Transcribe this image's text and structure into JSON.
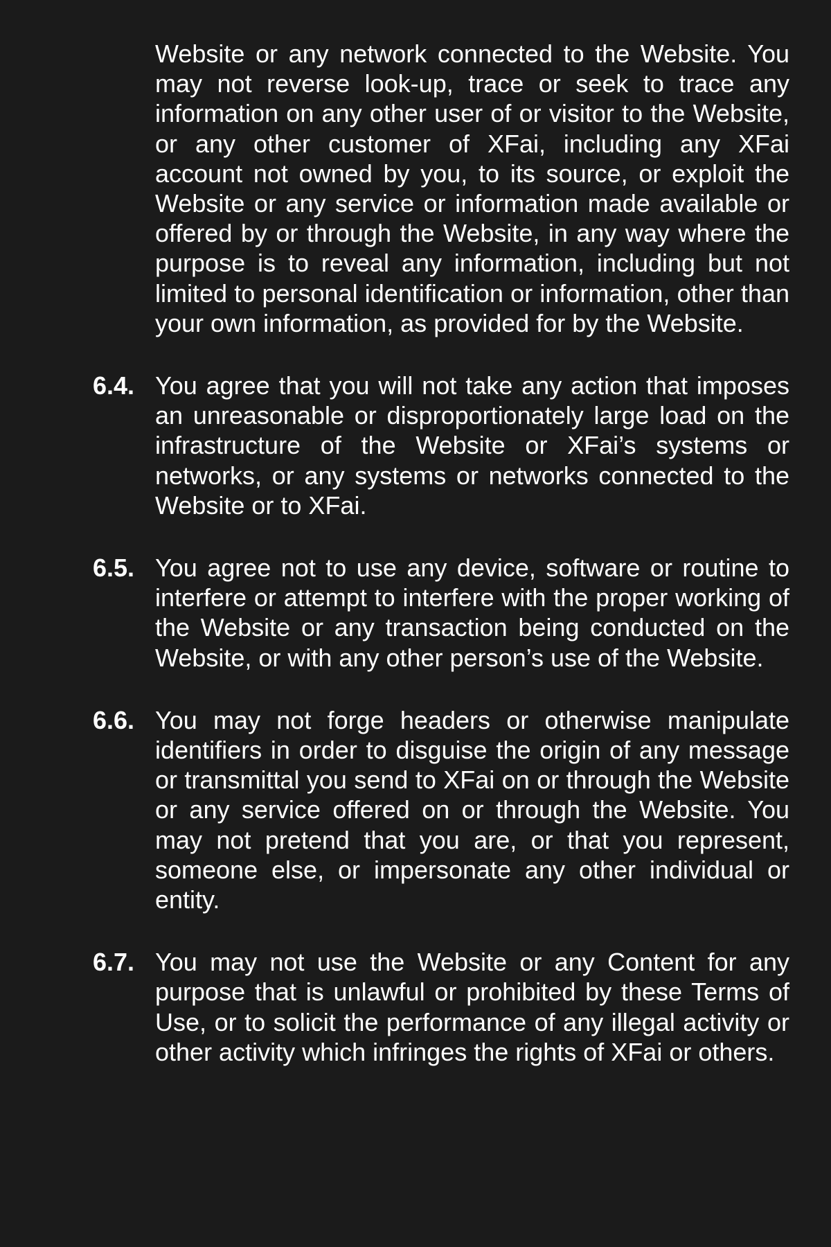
{
  "clauses": [
    {
      "number": "",
      "text": "Website or any network connected to the Website. You may not reverse look-up, trace or seek to trace any information on any other user of or visitor to the Website, or any other customer of XFai, including any XFai account not owned by you, to its source, or exploit the Website or any service or information made available or offered by or through the Website, in any way where the purpose is to reveal any information, including but not limited to personal identification or information, other than your own information, as provided for by the Website."
    },
    {
      "number": "6.4.",
      "text": "You agree that you will not take any action that imposes an unreasonable or disproportionately large load on the infrastructure of the Website or XFai’s systems or networks, or any systems or networks connected to the Website or to XFai."
    },
    {
      "number": "6.5.",
      "text": "You agree not to use any device, software or routine to interfere or attempt to interfere with the proper working of the Website or any transaction being conducted on the Website, or with any other person’s use of the Website."
    },
    {
      "number": "6.6.",
      "text": "You may not forge headers or otherwise manipulate identifiers in order to disguise the origin of any message or transmittal you send to XFai on or through the Website or any service offered on or through the Website. You may not pretend that you are, or that you represent, someone else, or impersonate any other individual or entity."
    },
    {
      "number": "6.7.",
      "text": "You may not use the Website or any Content for any purpose that is unlawful or prohibited by these Terms of Use, or to solicit the performance of any illegal activity or other activity which infringes the rights of XFai or others."
    }
  ]
}
